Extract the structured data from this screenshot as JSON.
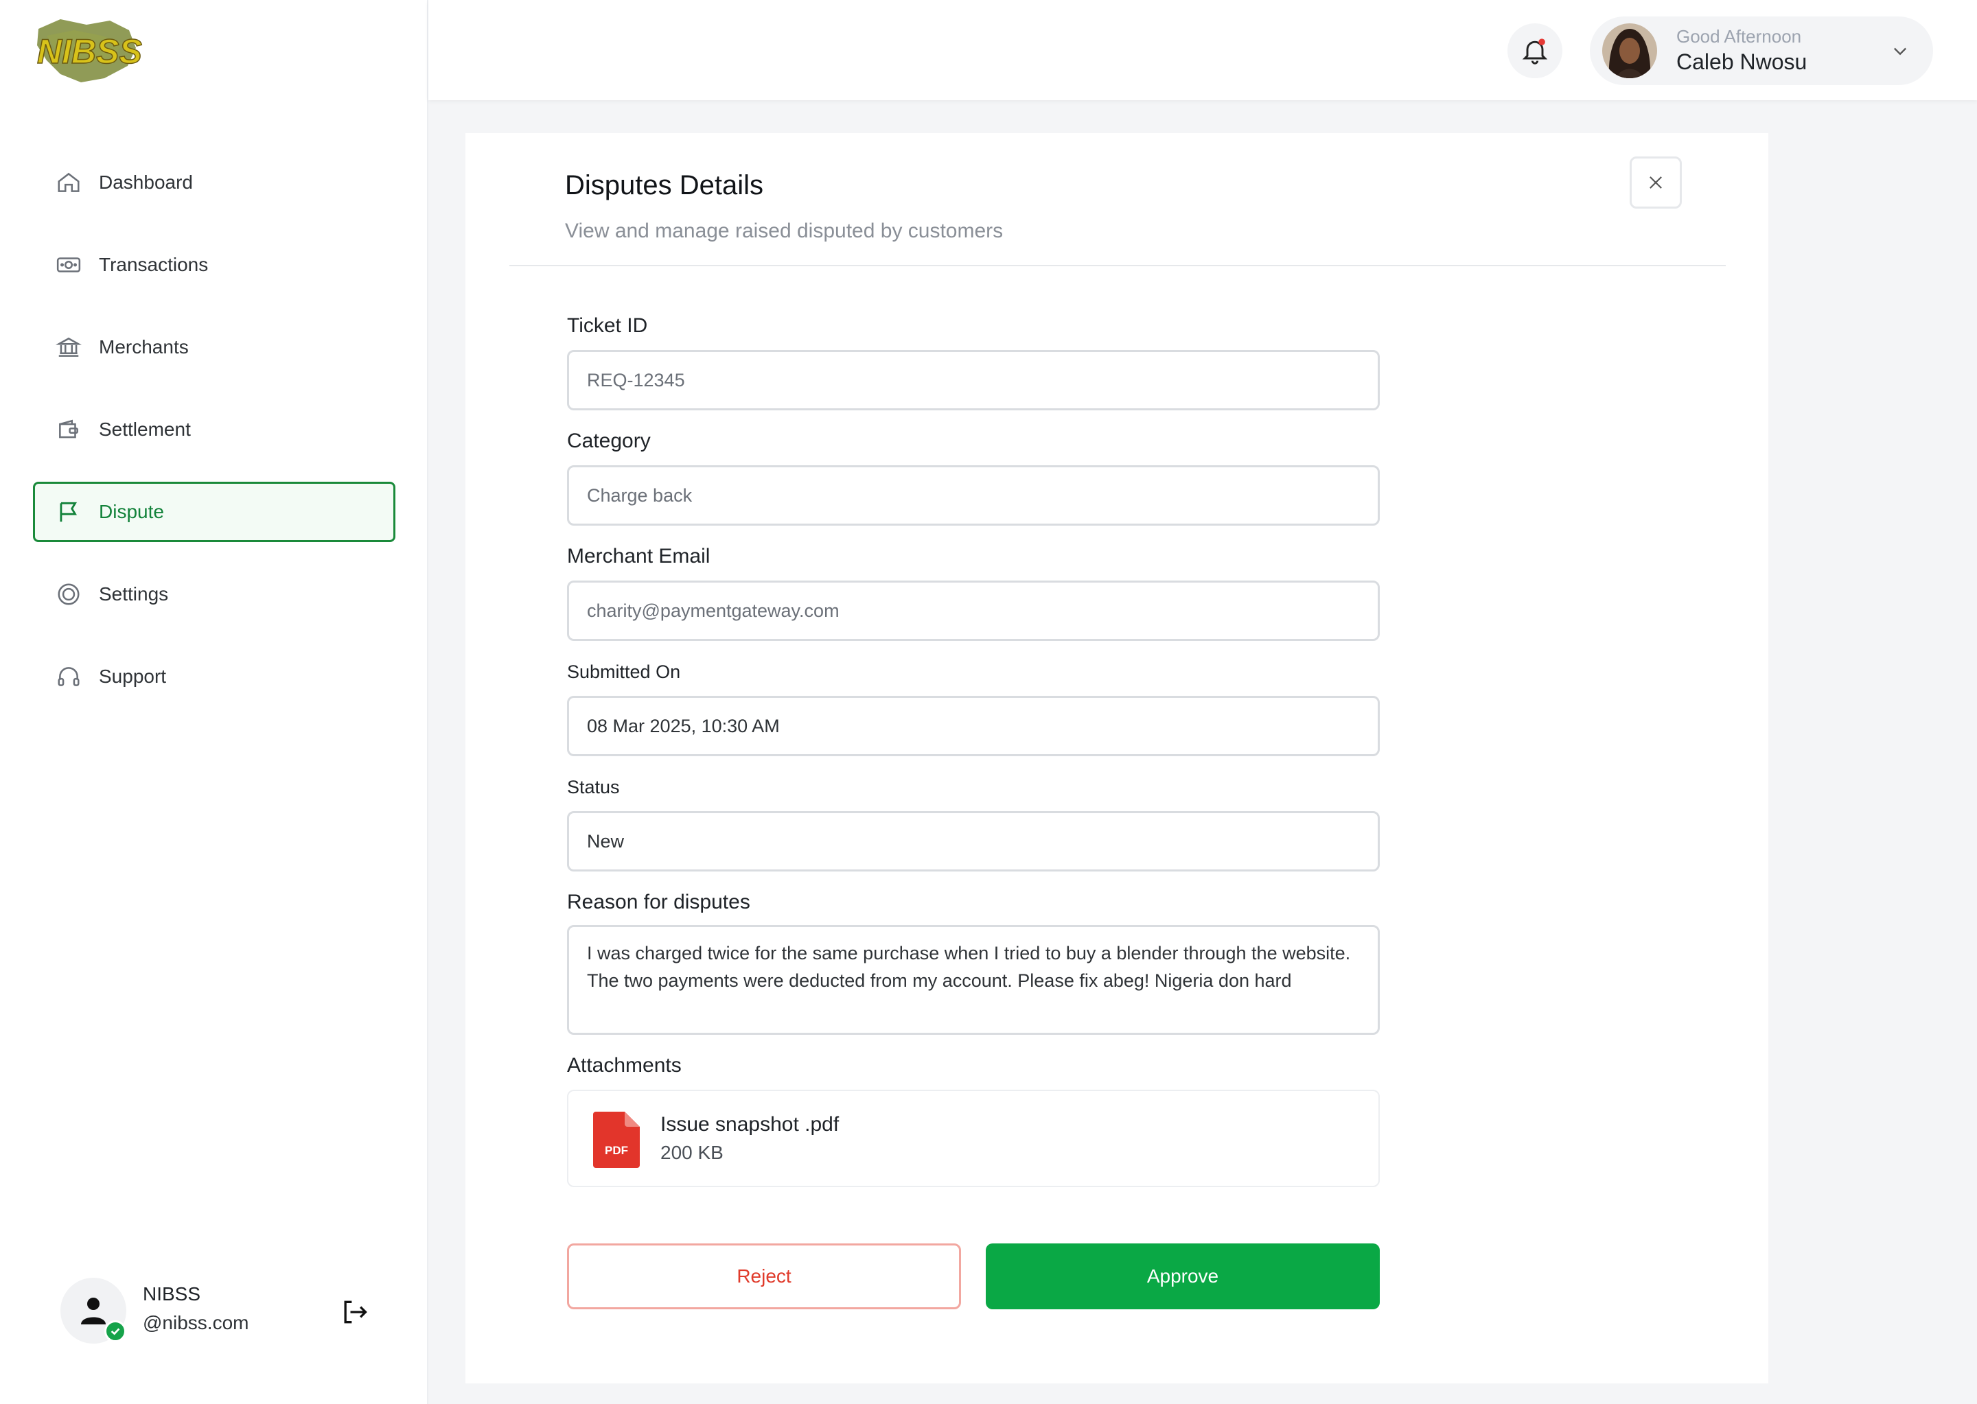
{
  "brand": {
    "logo_text": "NIBSS",
    "accent": "#1a8a3a"
  },
  "sidebar": {
    "items": [
      {
        "label": "Dashboard",
        "icon": "home-icon",
        "active": false
      },
      {
        "label": "Transactions",
        "icon": "money-icon",
        "active": false
      },
      {
        "label": "Merchants",
        "icon": "bank-icon",
        "active": false
      },
      {
        "label": "Settlement",
        "icon": "wallet-icon",
        "active": false
      },
      {
        "label": "Dispute",
        "icon": "flag-icon",
        "active": true
      },
      {
        "label": "Settings",
        "icon": "gear-icon",
        "active": false
      },
      {
        "label": "Support",
        "icon": "headset-icon",
        "active": false
      }
    ],
    "footer": {
      "name": "NIBSS",
      "email": "@nibss.com"
    }
  },
  "header": {
    "greeting": "Good Afternoon",
    "user_name": "Caleb Nwosu"
  },
  "panel": {
    "title": "Disputes Details",
    "subtitle": "View and manage raised disputed by customers",
    "fields": {
      "ticket_id": {
        "label": "Ticket ID",
        "value": "REQ-12345"
      },
      "category": {
        "label": "Category",
        "value": "Charge back"
      },
      "merchant_email": {
        "label": "Merchant Email",
        "value": "charity@paymentgateway.com"
      },
      "submitted_on": {
        "label": "Submitted On",
        "value": "08 Mar 2025, 10:30 AM"
      },
      "status": {
        "label": "Status",
        "value": "New"
      },
      "reason": {
        "label": "Reason for disputes",
        "value": "I was charged twice for the same purchase when I tried to buy a blender through the website. The two payments were deducted from my account. Please fix abeg! Nigeria don hard"
      }
    },
    "attachments": {
      "label": "Attachments",
      "file": {
        "name": "Issue snapshot .pdf",
        "size": "200 KB",
        "type": "PDF"
      }
    },
    "actions": {
      "reject": "Reject",
      "approve": "Approve"
    }
  },
  "colors": {
    "approve": "#0aa845",
    "reject": "#e03b2b",
    "pdf": "#e2352b"
  }
}
